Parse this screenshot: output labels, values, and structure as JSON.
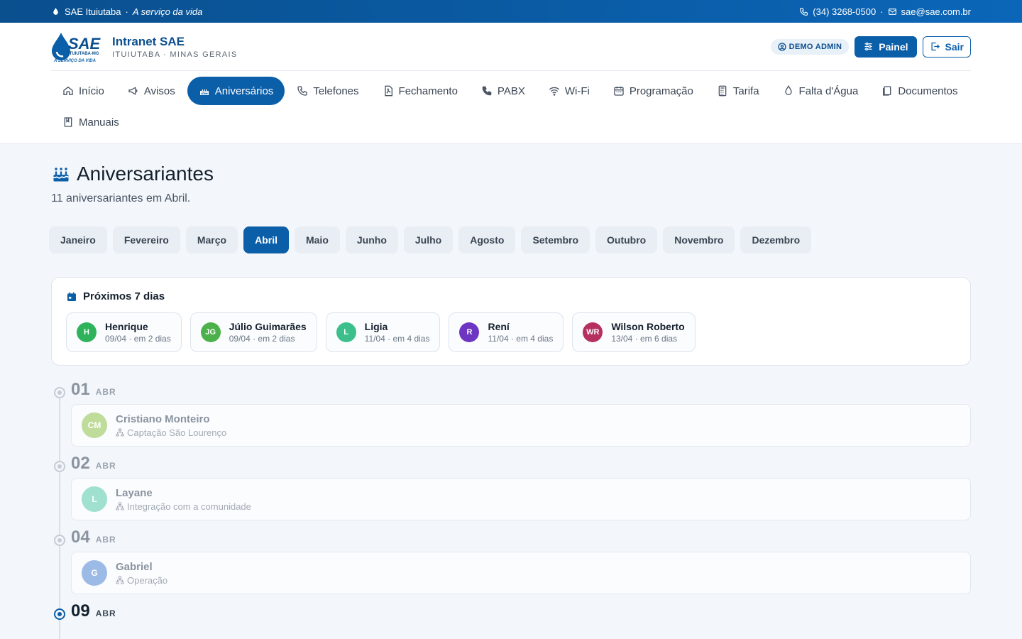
{
  "topbar": {
    "org": "SAE Ituiutaba",
    "sep": "·",
    "tagline": "A serviço da vida",
    "phone": "(34) 3268-0500",
    "dot": "·",
    "email": "sae@sae.com.br"
  },
  "brand": {
    "logo_text": "SAE",
    "logo_sub1": "ITUIUTABA-MG",
    "logo_sub2": "A SERVIÇO DA VIDA",
    "title": "Intranet SAE",
    "subtitle": "ITUIUTABA · MINAS GERAIS"
  },
  "actions": {
    "user_badge": "DEMO ADMIN",
    "painel": "Painel",
    "sair": "Sair"
  },
  "nav": {
    "items": [
      {
        "label": "Início",
        "icon": "home-icon"
      },
      {
        "label": "Avisos",
        "icon": "megaphone-icon"
      },
      {
        "label": "Aniversários",
        "icon": "cake-icon",
        "active": true
      },
      {
        "label": "Telefones",
        "icon": "phone-icon"
      },
      {
        "label": "Fechamento",
        "icon": "pdf-icon"
      },
      {
        "label": "PABX",
        "icon": "phone-filled-icon"
      },
      {
        "label": "Wi-Fi",
        "icon": "wifi-icon"
      },
      {
        "label": "Programação",
        "icon": "calendar-icon"
      },
      {
        "label": "Tarifa",
        "icon": "calculator-icon"
      },
      {
        "label": "Falta d'Água",
        "icon": "drop-icon"
      },
      {
        "label": "Documentos",
        "icon": "documents-icon"
      },
      {
        "label": "Manuais",
        "icon": "book-icon"
      }
    ]
  },
  "page": {
    "title": "Aniversariantes",
    "subtitle": "11 aniversariantes em Abril."
  },
  "months": {
    "items": [
      "Janeiro",
      "Fevereiro",
      "Março",
      "Abril",
      "Maio",
      "Junho",
      "Julho",
      "Agosto",
      "Setembro",
      "Outubro",
      "Novembro",
      "Dezembro"
    ],
    "selected": "Abril"
  },
  "upcoming": {
    "title": "Próximos 7 dias",
    "items": [
      {
        "initials": "H",
        "name": "Henrique",
        "meta": "09/04 · em 2 dias",
        "color": "#2fb35a"
      },
      {
        "initials": "JG",
        "name": "Júlio Guimarães",
        "meta": "09/04 · em 2 dias",
        "color": "#4cb14a"
      },
      {
        "initials": "L",
        "name": "Ligia",
        "meta": "11/04 · em 4 dias",
        "color": "#3cbf8a"
      },
      {
        "initials": "R",
        "name": "Rení",
        "meta": "11/04 · em 4 dias",
        "color": "#6d35c2"
      },
      {
        "initials": "WR",
        "name": "Wilson Roberto",
        "meta": "13/04 · em 6 dias",
        "color": "#b5305f"
      }
    ]
  },
  "timeline": {
    "groups": [
      {
        "day": "01",
        "mon": "ABR",
        "people": [
          {
            "initials": "CM",
            "name": "Cristiano Monteiro",
            "dept": "Captação São Lourenço",
            "color": "#bfdc9a"
          }
        ]
      },
      {
        "day": "02",
        "mon": "ABR",
        "people": [
          {
            "initials": "L",
            "name": "Layane",
            "dept": "Integração com a comunidade",
            "color": "#9fe0cf"
          }
        ]
      },
      {
        "day": "04",
        "mon": "ABR",
        "people": [
          {
            "initials": "G",
            "name": "Gabriel",
            "dept": "Operação",
            "color": "#9bbbe6"
          }
        ]
      },
      {
        "day": "09",
        "mon": "ABR",
        "current": true,
        "people": []
      }
    ]
  }
}
